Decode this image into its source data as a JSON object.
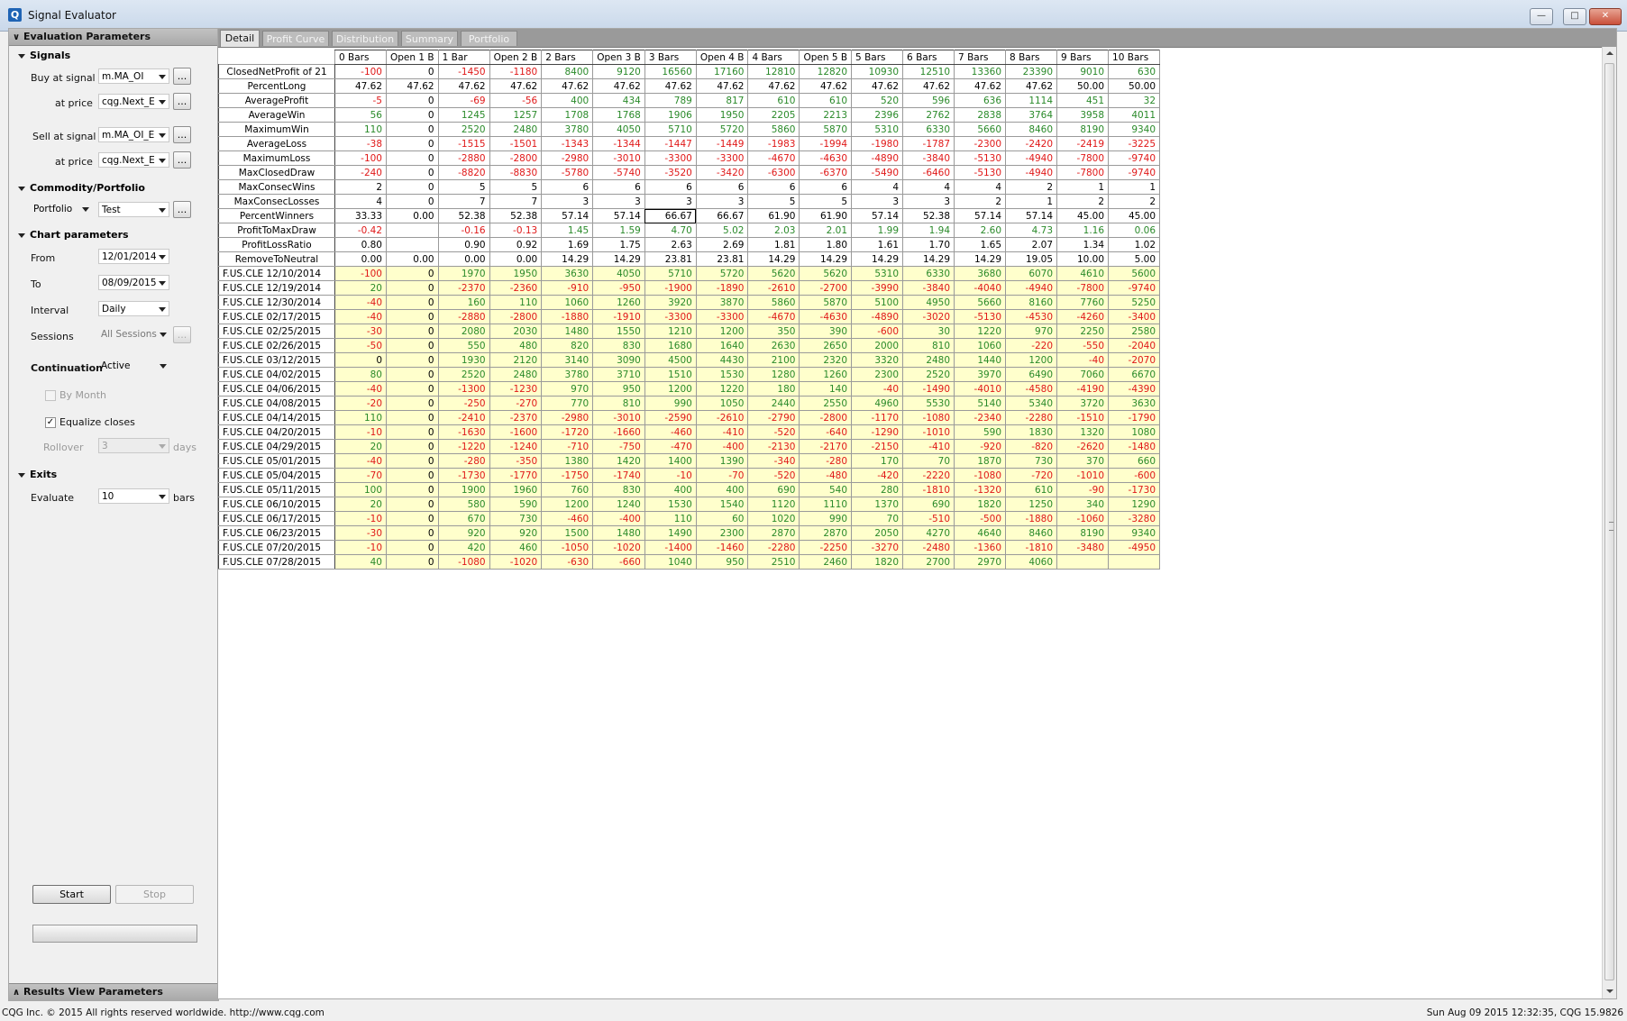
{
  "window": {
    "title": "Signal Evaluator",
    "app_icon": "Q"
  },
  "left_panel": {
    "header": "Evaluation Parameters",
    "footer": "Results View Parameters",
    "signals": {
      "title": "Signals",
      "buy_label": "Buy at signal",
      "buy_value": "m.MA_OI",
      "buy_price_label": "at price",
      "buy_price_value": "cqg.Next_E",
      "sell_label": "Sell at signal",
      "sell_value": "m.MA_OI_E",
      "sell_price_label": "at price",
      "sell_price_value": "cqg.Next_E"
    },
    "commodity": {
      "title": "Commodity/Portfolio",
      "label": "Portfolio",
      "value": "Test"
    },
    "chart": {
      "title": "Chart parameters",
      "from_label": "From",
      "from_value": "12/01/2014",
      "to_label": "To",
      "to_value": "08/09/2015",
      "interval_label": "Interval",
      "interval_value": "Daily",
      "sessions_label": "Sessions",
      "sessions_value": "All Sessions",
      "continuation_label": "Continuation",
      "continuation_value": "Active",
      "by_month_label": "By Month",
      "by_month_checked": false,
      "equalize_label": "Equalize closes",
      "equalize_checked": true,
      "rollover_label": "Rollover",
      "rollover_value": "3",
      "rollover_unit": "days"
    },
    "exits": {
      "title": "Exits",
      "evaluate_label": "Evaluate",
      "evaluate_value": "10",
      "evaluate_unit": "bars"
    },
    "start_label": "Start",
    "stop_label": "Stop",
    "ellipsis": "...",
    "progress": 0
  },
  "tabs": [
    "Detail",
    "Profit Curve",
    "Distribution",
    "Summary",
    "Portfolio"
  ],
  "active_tab": 0,
  "grid": {
    "columns": [
      "0 Bars",
      "Open 1 B",
      "1 Bar",
      "Open 2 B",
      "2 Bars",
      "Open 3 B",
      "3 Bars",
      "Open 4 B",
      "4 Bars",
      "Open 5 B",
      "5 Bars",
      "6 Bars",
      "7 Bars",
      "8 Bars",
      "9 Bars",
      "10 Bars"
    ],
    "stat_rows": [
      {
        "label": "ClosedNetProfit of 21",
        "values": [
          "-100",
          "0",
          "-1450",
          "-1180",
          "8400",
          "9120",
          "16560",
          "17160",
          "12810",
          "12820",
          "10930",
          "12510",
          "13360",
          "23390",
          "9010",
          "630"
        ]
      },
      {
        "label": "PercentLong",
        "values": [
          "47.62",
          "47.62",
          "47.62",
          "47.62",
          "47.62",
          "47.62",
          "47.62",
          "47.62",
          "47.62",
          "47.62",
          "47.62",
          "47.62",
          "47.62",
          "47.62",
          "50.00",
          "50.00"
        ]
      },
      {
        "label": "AverageProfit",
        "values": [
          "-5",
          "0",
          "-69",
          "-56",
          "400",
          "434",
          "789",
          "817",
          "610",
          "610",
          "520",
          "596",
          "636",
          "1114",
          "451",
          "32"
        ]
      },
      {
        "label": "AverageWin",
        "values": [
          "56",
          "0",
          "1245",
          "1257",
          "1708",
          "1768",
          "1906",
          "1950",
          "2205",
          "2213",
          "2396",
          "2762",
          "2838",
          "3764",
          "3958",
          "4011"
        ]
      },
      {
        "label": "MaximumWin",
        "values": [
          "110",
          "0",
          "2520",
          "2480",
          "3780",
          "4050",
          "5710",
          "5720",
          "5860",
          "5870",
          "5310",
          "6330",
          "5660",
          "8460",
          "8190",
          "9340"
        ]
      },
      {
        "label": "AverageLoss",
        "values": [
          "-38",
          "0",
          "-1515",
          "-1501",
          "-1343",
          "-1344",
          "-1447",
          "-1449",
          "-1983",
          "-1994",
          "-1980",
          "-1787",
          "-2300",
          "-2420",
          "-2419",
          "-3225"
        ]
      },
      {
        "label": "MaximumLoss",
        "values": [
          "-100",
          "0",
          "-2880",
          "-2800",
          "-2980",
          "-3010",
          "-3300",
          "-3300",
          "-4670",
          "-4630",
          "-4890",
          "-3840",
          "-5130",
          "-4940",
          "-7800",
          "-9740"
        ]
      },
      {
        "label": "MaxClosedDraw",
        "values": [
          "-240",
          "0",
          "-8820",
          "-8830",
          "-5780",
          "-5740",
          "-3520",
          "-3420",
          "-6300",
          "-6370",
          "-5490",
          "-6460",
          "-5130",
          "-4940",
          "-7800",
          "-9740"
        ]
      },
      {
        "label": "MaxConsecWins",
        "values": [
          "2",
          "0",
          "5",
          "5",
          "6",
          "6",
          "6",
          "6",
          "6",
          "6",
          "4",
          "4",
          "4",
          "2",
          "1",
          "1"
        ]
      },
      {
        "label": "MaxConsecLosses",
        "values": [
          "4",
          "0",
          "7",
          "7",
          "3",
          "3",
          "3",
          "3",
          "5",
          "5",
          "3",
          "3",
          "2",
          "1",
          "2",
          "2"
        ]
      },
      {
        "label": "PercentWinners",
        "values": [
          "33.33",
          "0.00",
          "52.38",
          "52.38",
          "57.14",
          "57.14",
          "66.67",
          "66.67",
          "61.90",
          "61.90",
          "57.14",
          "52.38",
          "57.14",
          "57.14",
          "45.00",
          "45.00"
        ]
      },
      {
        "label": "ProfitToMaxDraw",
        "values": [
          "-0.42",
          "",
          "-0.16",
          "-0.13",
          "1.45",
          "1.59",
          "4.70",
          "5.02",
          "2.03",
          "2.01",
          "1.99",
          "1.94",
          "2.60",
          "4.73",
          "1.16",
          "0.06"
        ]
      },
      {
        "label": "ProfitLossRatio",
        "values": [
          "0.80",
          "",
          "0.90",
          "0.92",
          "1.69",
          "1.75",
          "2.63",
          "2.69",
          "1.81",
          "1.80",
          "1.61",
          "1.70",
          "1.65",
          "2.07",
          "1.34",
          "1.02"
        ]
      },
      {
        "label": "RemoveToNeutral",
        "values": [
          "0.00",
          "0.00",
          "0.00",
          "0.00",
          "14.29",
          "14.29",
          "23.81",
          "23.81",
          "14.29",
          "14.29",
          "14.29",
          "14.29",
          "14.29",
          "19.05",
          "10.00",
          "5.00"
        ]
      }
    ],
    "trade_rows": [
      {
        "label": "F.US.CLE  12/10/2014",
        "values": [
          "-100",
          "0",
          "1970",
          "1950",
          "3630",
          "4050",
          "5710",
          "5720",
          "5620",
          "5620",
          "5310",
          "6330",
          "3680",
          "6070",
          "4610",
          "5600"
        ]
      },
      {
        "label": "F.US.CLE  12/19/2014",
        "values": [
          "20",
          "0",
          "-2370",
          "-2360",
          "-910",
          "-950",
          "-1900",
          "-1890",
          "-2610",
          "-2700",
          "-3990",
          "-3840",
          "-4040",
          "-4940",
          "-7800",
          "-9740"
        ]
      },
      {
        "label": "F.US.CLE  12/30/2014",
        "values": [
          "-40",
          "0",
          "160",
          "110",
          "1060",
          "1260",
          "3920",
          "3870",
          "5860",
          "5870",
          "5100",
          "4950",
          "5660",
          "8160",
          "7760",
          "5250"
        ]
      },
      {
        "label": "F.US.CLE  02/17/2015",
        "values": [
          "-40",
          "0",
          "-2880",
          "-2800",
          "-1880",
          "-1910",
          "-3300",
          "-3300",
          "-4670",
          "-4630",
          "-4890",
          "-3020",
          "-5130",
          "-4530",
          "-4260",
          "-3400"
        ]
      },
      {
        "label": "F.US.CLE  02/25/2015",
        "values": [
          "-30",
          "0",
          "2080",
          "2030",
          "1480",
          "1550",
          "1210",
          "1200",
          "350",
          "390",
          "-600",
          "30",
          "1220",
          "970",
          "2250",
          "2580"
        ]
      },
      {
        "label": "F.US.CLE  02/26/2015",
        "values": [
          "-50",
          "0",
          "550",
          "480",
          "820",
          "830",
          "1680",
          "1640",
          "2630",
          "2650",
          "2000",
          "810",
          "1060",
          "-220",
          "-550",
          "-2040"
        ]
      },
      {
        "label": "F.US.CLE  03/12/2015",
        "values": [
          "0",
          "0",
          "1930",
          "2120",
          "3140",
          "3090",
          "4500",
          "4430",
          "2100",
          "2320",
          "3320",
          "2480",
          "1440",
          "1200",
          "-40",
          "-2070"
        ]
      },
      {
        "label": "F.US.CLE  04/02/2015",
        "values": [
          "80",
          "0",
          "2520",
          "2480",
          "3780",
          "3710",
          "1510",
          "1530",
          "1280",
          "1260",
          "2300",
          "2520",
          "3970",
          "6490",
          "7060",
          "6670"
        ]
      },
      {
        "label": "F.US.CLE  04/06/2015",
        "values": [
          "-40",
          "0",
          "-1300",
          "-1230",
          "970",
          "950",
          "1200",
          "1220",
          "180",
          "140",
          "-40",
          "-1490",
          "-4010",
          "-4580",
          "-4190",
          "-4390"
        ]
      },
      {
        "label": "F.US.CLE  04/08/2015",
        "values": [
          "-20",
          "0",
          "-250",
          "-270",
          "770",
          "810",
          "990",
          "1050",
          "2440",
          "2550",
          "4960",
          "5530",
          "5140",
          "5340",
          "3720",
          "3630"
        ]
      },
      {
        "label": "F.US.CLE  04/14/2015",
        "values": [
          "110",
          "0",
          "-2410",
          "-2370",
          "-2980",
          "-3010",
          "-2590",
          "-2610",
          "-2790",
          "-2800",
          "-1170",
          "-1080",
          "-2340",
          "-2280",
          "-1510",
          "-1790"
        ]
      },
      {
        "label": "F.US.CLE  04/20/2015",
        "values": [
          "-10",
          "0",
          "-1630",
          "-1600",
          "-1720",
          "-1660",
          "-460",
          "-410",
          "-520",
          "-640",
          "-1290",
          "-1010",
          "590",
          "1830",
          "1320",
          "1080"
        ]
      },
      {
        "label": "F.US.CLE  04/29/2015",
        "values": [
          "20",
          "0",
          "-1220",
          "-1240",
          "-710",
          "-750",
          "-470",
          "-400",
          "-2130",
          "-2170",
          "-2150",
          "-410",
          "-920",
          "-820",
          "-2620",
          "-1480"
        ]
      },
      {
        "label": "F.US.CLE  05/01/2015",
        "values": [
          "-40",
          "0",
          "-280",
          "-350",
          "1380",
          "1420",
          "1400",
          "1390",
          "-340",
          "-280",
          "170",
          "70",
          "1870",
          "730",
          "370",
          "660"
        ]
      },
      {
        "label": "F.US.CLE  05/04/2015",
        "values": [
          "-70",
          "0",
          "-1730",
          "-1770",
          "-1750",
          "-1740",
          "-10",
          "-70",
          "-520",
          "-480",
          "-420",
          "-2220",
          "-1080",
          "-720",
          "-1010",
          "-600"
        ]
      },
      {
        "label": "F.US.CLE  05/11/2015",
        "values": [
          "100",
          "0",
          "1900",
          "1960",
          "760",
          "830",
          "400",
          "400",
          "690",
          "540",
          "280",
          "-1810",
          "-1320",
          "610",
          "-90",
          "-1730"
        ]
      },
      {
        "label": "F.US.CLE  06/10/2015",
        "values": [
          "20",
          "0",
          "580",
          "590",
          "1200",
          "1240",
          "1530",
          "1540",
          "1120",
          "1110",
          "1370",
          "690",
          "1820",
          "1250",
          "340",
          "1290"
        ]
      },
      {
        "label": "F.US.CLE  06/17/2015",
        "values": [
          "-10",
          "0",
          "670",
          "730",
          "-460",
          "-400",
          "110",
          "60",
          "1020",
          "990",
          "70",
          "-510",
          "-500",
          "-1880",
          "-1060",
          "-3280"
        ]
      },
      {
        "label": "F.US.CLE  06/23/2015",
        "values": [
          "-30",
          "0",
          "920",
          "920",
          "1500",
          "1480",
          "1490",
          "2300",
          "2870",
          "2870",
          "2050",
          "4270",
          "4640",
          "8460",
          "8190",
          "9340"
        ]
      },
      {
        "label": "F.US.CLE  07/20/2015",
        "values": [
          "-10",
          "0",
          "420",
          "460",
          "-1050",
          "-1020",
          "-1400",
          "-1460",
          "-2280",
          "-2250",
          "-3270",
          "-2480",
          "-1360",
          "-1810",
          "-3480",
          "-4950"
        ]
      },
      {
        "label": "F.US.CLE  07/28/2015",
        "values": [
          "40",
          "0",
          "-1080",
          "-1020",
          "-630",
          "-660",
          "1040",
          "950",
          "2510",
          "2460",
          "1820",
          "2700",
          "2970",
          "4060",
          "",
          ""
        ]
      }
    ],
    "colors": {
      "positive": "#2a8a2a",
      "negative": "#e01818",
      "trade_row_bg": "#ffffcc"
    }
  },
  "status_bar": {
    "left": "CQG Inc. © 2015 All rights reserved worldwide. http://www.cqg.com",
    "right": "Sun Aug 09 2015 12:32:35, CQG 15.9826"
  }
}
